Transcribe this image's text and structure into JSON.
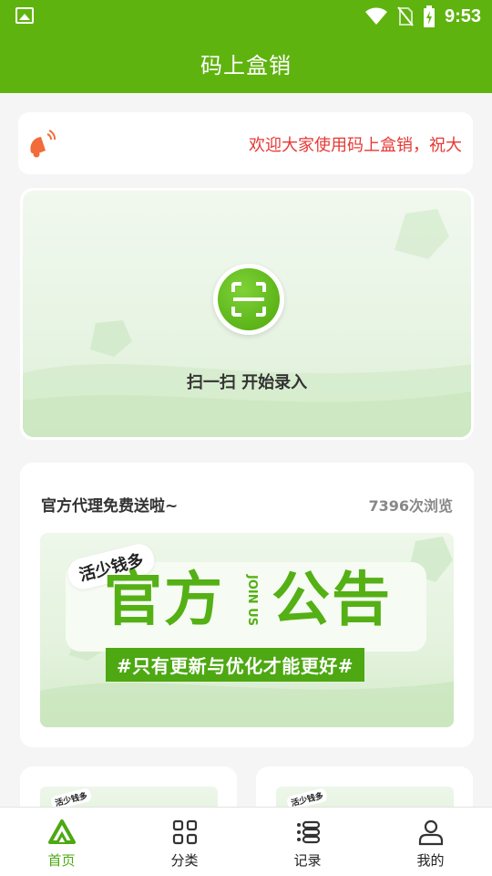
{
  "status_bar": {
    "time": "9:53",
    "icons": [
      "image-icon",
      "wifi-icon",
      "no-sim-icon",
      "battery-charging-icon"
    ]
  },
  "header": {
    "title": "码上盒销"
  },
  "notice": {
    "icon": "megaphone-icon",
    "text": "欢迎大家使用码上盒销，祝大"
  },
  "scan": {
    "icon": "scan-icon",
    "label": "扫一扫 开始录入"
  },
  "announcement": {
    "title": "官方代理免费送啦~",
    "views": "7396次浏览",
    "banner": {
      "tag": "活少钱多",
      "headline_left": "官方",
      "join_text": "JOIN US",
      "headline_right": "公告",
      "slogan": "#只有更新与优化才能更好#"
    }
  },
  "mini_cards": [
    {
      "tag": "活少钱多"
    },
    {
      "tag": "活少钱多"
    }
  ],
  "bottom_nav": [
    {
      "label": "首页",
      "icon": "home-icon",
      "active": true
    },
    {
      "label": "分类",
      "icon": "grid-icon",
      "active": false
    },
    {
      "label": "记录",
      "icon": "list-icon",
      "active": false
    },
    {
      "label": "我的",
      "icon": "user-icon",
      "active": false
    }
  ],
  "colors": {
    "brand": "#5fb30f",
    "accent_red": "#e53935",
    "active_nav": "#4da812"
  }
}
